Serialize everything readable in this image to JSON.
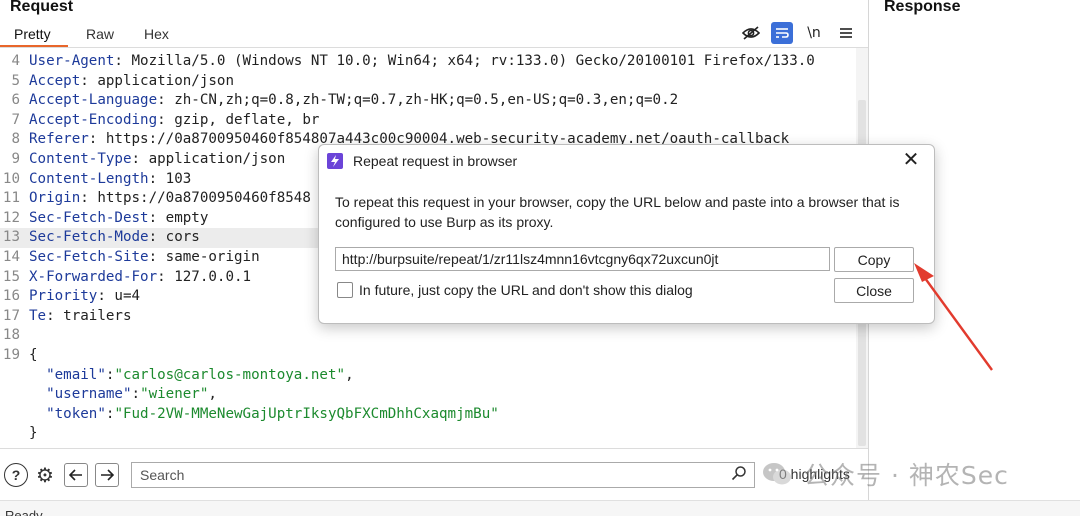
{
  "request": {
    "title": "Request",
    "tabs": [
      "Pretty",
      "Raw",
      "Hex"
    ],
    "toolbar": {
      "hide_icon": "eye-slash-icon",
      "wrap_icon": "word-wrap-icon",
      "newline_label": "\\n",
      "menu_icon": "hamburger-menu-icon"
    },
    "lines": [
      {
        "n": "4",
        "kind": "header",
        "name": "User-Agent",
        "value": " Mozilla/5.0 (Windows NT 10.0; Win64; x64; rv:133.0) Gecko/20100101 Firefox/133.0"
      },
      {
        "n": "5",
        "kind": "header",
        "name": "Accept",
        "value": " application/json"
      },
      {
        "n": "6",
        "kind": "header",
        "name": "Accept-Language",
        "value": " zh-CN,zh;q=0.8,zh-TW;q=0.7,zh-HK;q=0.5,en-US;q=0.3,en;q=0.2"
      },
      {
        "n": "7",
        "kind": "header",
        "name": "Accept-Encoding",
        "value": " gzip, deflate, br"
      },
      {
        "n": "8",
        "kind": "header",
        "name": "Referer",
        "value": " https://0a8700950460f854807a443c00c90004.web-security-academy.net/oauth-callback"
      },
      {
        "n": "9",
        "kind": "header",
        "name": "Content-Type",
        "value": " application/json"
      },
      {
        "n": "10",
        "kind": "header",
        "name": "Content-Length",
        "value": " 103"
      },
      {
        "n": "11",
        "kind": "header",
        "name": "Origin",
        "value": " https://0a8700950460f8548"
      },
      {
        "n": "12",
        "kind": "header",
        "name": "Sec-Fetch-Dest",
        "value": " empty"
      },
      {
        "n": "13",
        "kind": "header",
        "name": "Sec-Fetch-Mode",
        "value": " cors",
        "highlight": true
      },
      {
        "n": "14",
        "kind": "header",
        "name": "Sec-Fetch-Site",
        "value": " same-origin"
      },
      {
        "n": "15",
        "kind": "header",
        "name": "X-Forwarded-For",
        "value": " 127.0.0.1"
      },
      {
        "n": "16",
        "kind": "header",
        "name": "Priority",
        "value": " u=4"
      },
      {
        "n": "17",
        "kind": "header",
        "name": "Te",
        "value": " trailers"
      },
      {
        "n": "18",
        "kind": "blank"
      },
      {
        "n": "19",
        "kind": "plain",
        "text": "{"
      },
      {
        "n": "",
        "kind": "json",
        "key": "\"email\"",
        "value": "\"carlos@carlos-montoya.net\"",
        "trail": ","
      },
      {
        "n": "",
        "kind": "json",
        "key": "\"username\"",
        "value": "\"wiener\"",
        "trail": ","
      },
      {
        "n": "",
        "kind": "json",
        "key": "\"token\"",
        "value": "\"Fud-2VW-MMeNewGajUptrIksyQbFXCmDhhCxaqmjmBu\"",
        "trail": ""
      },
      {
        "n": "",
        "kind": "plain",
        "text": "}"
      }
    ]
  },
  "search": {
    "placeholder": "Search",
    "highlights": "0 highlights",
    "help_icon": "help-icon",
    "settings_icon": "gear-icon",
    "back_icon": "arrow-left-icon",
    "forward_icon": "arrow-right-icon",
    "go_icon": "search-icon"
  },
  "response": {
    "title": "Response"
  },
  "status": {
    "text": "Ready"
  },
  "dialog": {
    "title": "Repeat request in browser",
    "message": "To repeat this request in your browser, copy the URL below and paste into a browser that is configured to use Burp as its proxy.",
    "url": "http://burpsuite/repeat/1/zr11lsz4mnn16vtcgny6qx72uxcun0jt",
    "copy_label": "Copy",
    "close_label": "Close",
    "checkbox_label": "In future, just copy the URL and don't show this dialog",
    "checkbox_checked": false
  },
  "watermark": {
    "text": "公众号 · 神农Sec"
  },
  "colors": {
    "accent_tab": "#e8662b",
    "burp_icon": "#6b44d8",
    "wrap_active": "#3b6fd8",
    "header_name": "#1d3a9a",
    "json_string": "#1c8a2e",
    "arrow": "#e23b2e"
  }
}
